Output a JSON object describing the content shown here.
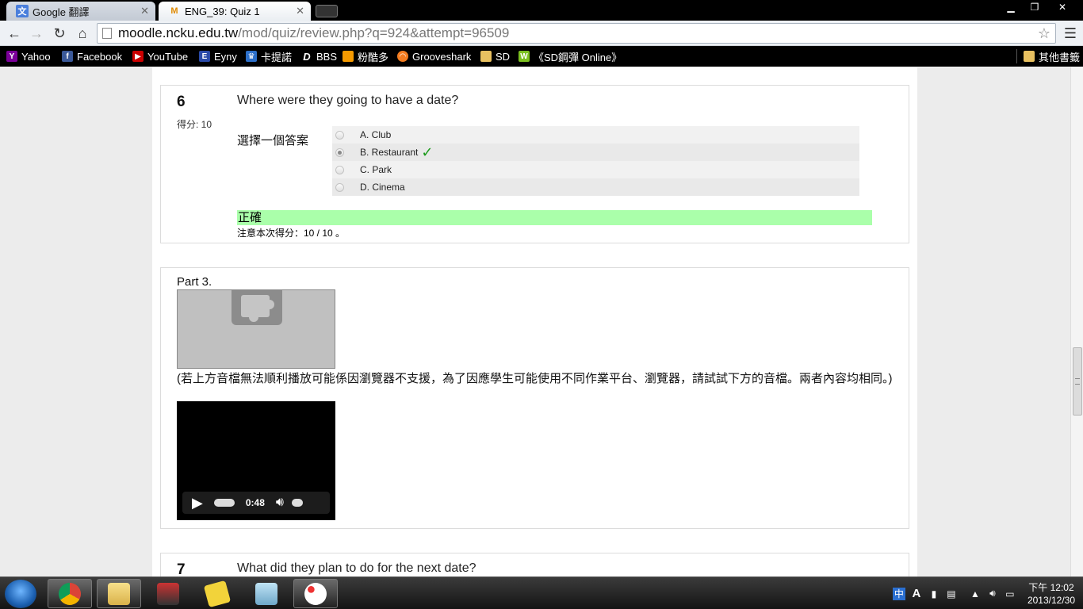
{
  "tabs": [
    {
      "title": "Google 翻譯",
      "active": false
    },
    {
      "title": "ENG_39: Quiz 1",
      "active": true
    }
  ],
  "address": {
    "host": "moodle.ncku.edu.tw",
    "path": "/mod/quiz/review.php?q=924&attempt=96509"
  },
  "bookmarks": [
    {
      "label": "Yahoo",
      "icon": "yahoo-icon",
      "color": "#7b0099"
    },
    {
      "label": "Facebook",
      "icon": "facebook-icon",
      "color": "#3b5998"
    },
    {
      "label": "YouTube",
      "icon": "youtube-icon",
      "color": "#cc0000"
    },
    {
      "label": "Eyny",
      "icon": "eyny-icon",
      "color": "#2a4aa8"
    },
    {
      "label": "卡提諾",
      "icon": "crown-icon",
      "color": "#2c6fc9"
    },
    {
      "label": "BBS",
      "icon": "d-icon",
      "color": "#000000"
    },
    {
      "label": "粉酷多",
      "icon": "square-icon",
      "color": "#f59a00"
    },
    {
      "label": "Grooveshark",
      "icon": "grooveshark-icon",
      "color": "#f37c20"
    },
    {
      "label": "SD",
      "icon": "folder-icon",
      "color": "#e8c060"
    },
    {
      "label": "《SD鋼彈 Online》",
      "icon": "w-icon",
      "color": "#7cc020"
    }
  ],
  "other_bookmarks": "其他書籤",
  "question6": {
    "number": "6",
    "grade": "得分: 10",
    "text": "Where were they going to have a date?",
    "prompt": "選擇一個答案",
    "answers": [
      {
        "label": "A. Club",
        "selected": false,
        "correct": false
      },
      {
        "label": "B. Restaurant",
        "selected": true,
        "correct": true
      },
      {
        "label": "C. Park",
        "selected": false,
        "correct": false
      },
      {
        "label": "D. Cinema",
        "selected": false,
        "correct": false
      }
    ],
    "feedback": "正確",
    "marks": "注意本次得分：10 / 10 。",
    "feedback_color": "#aaffaa"
  },
  "part3": {
    "title": "Part 3.",
    "note": "(若上方音檔無法順利播放可能係因瀏覽器不支援，為了因應學生可能使用不同作業平台、瀏覽器，請試試下方的音檔。兩者內容均相同。)",
    "video_time": "0:48"
  },
  "question7": {
    "number": "7",
    "text": "What did they plan to do for the next date?"
  },
  "taskbar": {
    "clock_time": "下午 12:02",
    "clock_date": "2013/12/30"
  }
}
